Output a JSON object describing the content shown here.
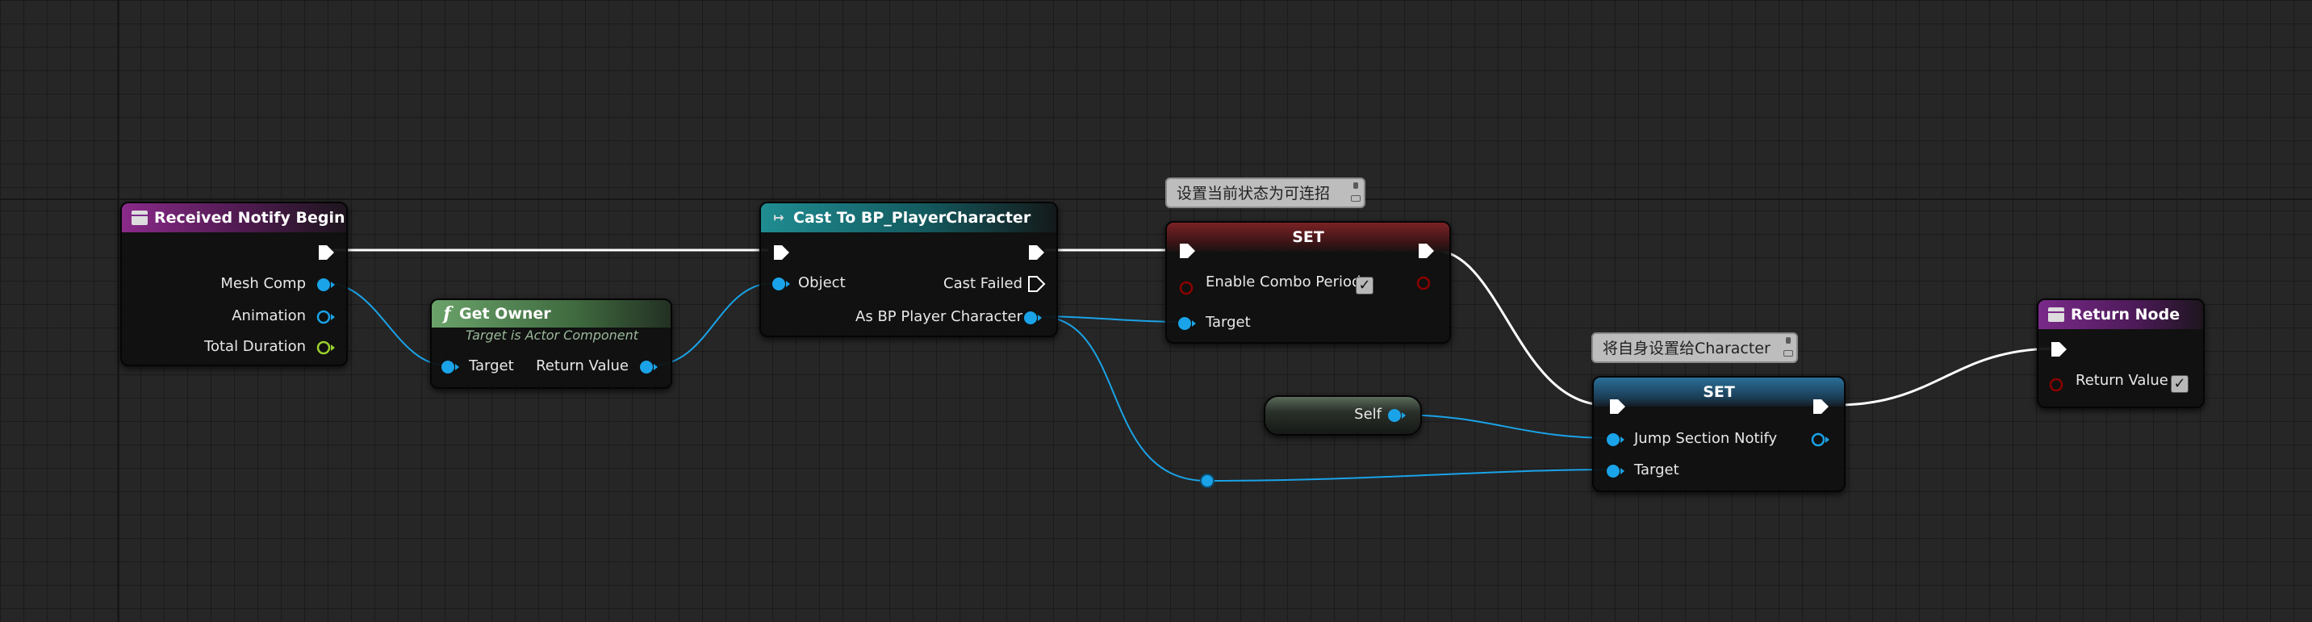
{
  "graph": {
    "nodes": {
      "received_notify_begin": {
        "title": "Received Notify Begin",
        "outputs": [
          "Mesh Comp",
          "Animation",
          "Total Duration"
        ]
      },
      "get_owner": {
        "title": "Get Owner",
        "subtitle": "Target is Actor Component",
        "input": "Target",
        "output": "Return Value"
      },
      "cast": {
        "title": "Cast To BP_PlayerCharacter",
        "input": "Object",
        "cast_failed": "Cast Failed",
        "output": "As BP Player Character"
      },
      "set_combo": {
        "title": "SET",
        "comment": "设置当前状态为可连招",
        "variable": "Enable Combo Period",
        "target": "Target",
        "checked": "✓"
      },
      "self": {
        "label": "Self"
      },
      "set_jump": {
        "title": "SET",
        "comment": "将自身设置给Character",
        "variable": "Jump Section Notify",
        "target": "Target"
      },
      "return_node": {
        "title": "Return Node",
        "output": "Return Value",
        "checked": "✓"
      }
    },
    "colors": {
      "exec": "#ffffff",
      "object_pin": "#1aa3e8",
      "bool_pin": "#8c0000",
      "float_pin": "#9bd12d"
    }
  }
}
